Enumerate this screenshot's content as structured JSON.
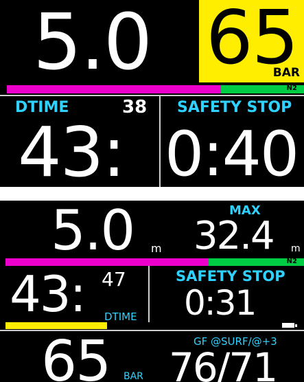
{
  "screen1": {
    "depth": "5.0",
    "tank_pressure": "65",
    "tank_unit": "BAR",
    "gas_label": "N2",
    "dtime_label": "DTIME",
    "dtime_value": "38",
    "safety_stop_label": "SAFETY STOP",
    "dive_time_main": "43:",
    "safety_stop_timer": "0:40",
    "n2_fraction": 0.72,
    "colors": {
      "pressure_bg": "#ffee00",
      "magenta": "#ee00cc",
      "green": "#00cc44",
      "cyan": "#2fd2ff"
    }
  },
  "screen2": {
    "depth": "5.0",
    "depth_unit": "m",
    "max_label": "MAX",
    "max_depth": "32.4",
    "max_unit": "m",
    "gas_label": "N2",
    "dive_time_main": "43:",
    "dive_time_seconds": "47",
    "dtime_label": "DTIME",
    "safety_stop_label": "SAFETY STOP",
    "safety_stop_timer": "0:31",
    "n2_fraction": 0.68,
    "battery_fraction": 0.34,
    "tank_pressure": "65",
    "tank_unit": "BAR",
    "gf_label": "GF @SURF/@+3",
    "gf_value": "76/71"
  }
}
